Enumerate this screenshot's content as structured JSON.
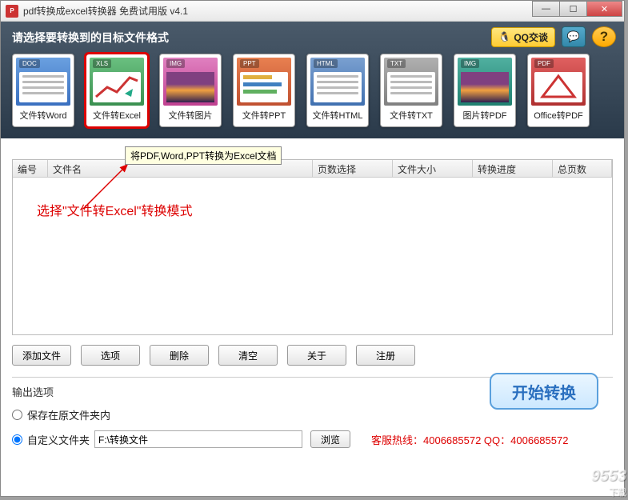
{
  "window": {
    "title": "pdf转换成excel转换器 免费试用版 v4.1"
  },
  "header": {
    "prompt": "请选择要转换到的目标文件格式",
    "qq_label": "QQ交谈"
  },
  "formats": [
    {
      "tab": "DOC",
      "label": "文件转Word",
      "cls": "fi-doc"
    },
    {
      "tab": "XLS",
      "label": "文件转Excel",
      "cls": "fi-xls",
      "selected": true
    },
    {
      "tab": "IMG",
      "label": "文件转图片",
      "cls": "fi-img"
    },
    {
      "tab": "PPT",
      "label": "文件转PPT",
      "cls": "fi-ppt"
    },
    {
      "tab": "HTML",
      "label": "文件转HTML",
      "cls": "fi-html"
    },
    {
      "tab": "TXT",
      "label": "文件转TXT",
      "cls": "fi-txt"
    },
    {
      "tab": "IMG",
      "label": "图片转PDF",
      "cls": "fi-img2"
    },
    {
      "tab": "PDF",
      "label": "Office转PDF",
      "cls": "fi-pdf"
    }
  ],
  "tooltip": "将PDF,Word,PPT转换为Excel文档",
  "table": {
    "columns": [
      "编号",
      "文件名",
      "页数选择",
      "文件大小",
      "转换进度",
      "总页数"
    ]
  },
  "annotation": "选择\"文件转Excel\"转换模式",
  "buttons": {
    "add": "添加文件",
    "options": "选项",
    "delete": "删除",
    "clear": "清空",
    "about": "关于",
    "register": "注册"
  },
  "output": {
    "title": "输出选项",
    "save_original": "保存在原文件夹内",
    "custom_folder": "自定义文件夹",
    "path": "F:\\转换文件",
    "browse": "浏览",
    "hotline": "客服热线：4006685572 QQ：4006685572"
  },
  "start": "开始转换",
  "watermark": {
    "brand": "9553",
    "sub": "下载"
  }
}
